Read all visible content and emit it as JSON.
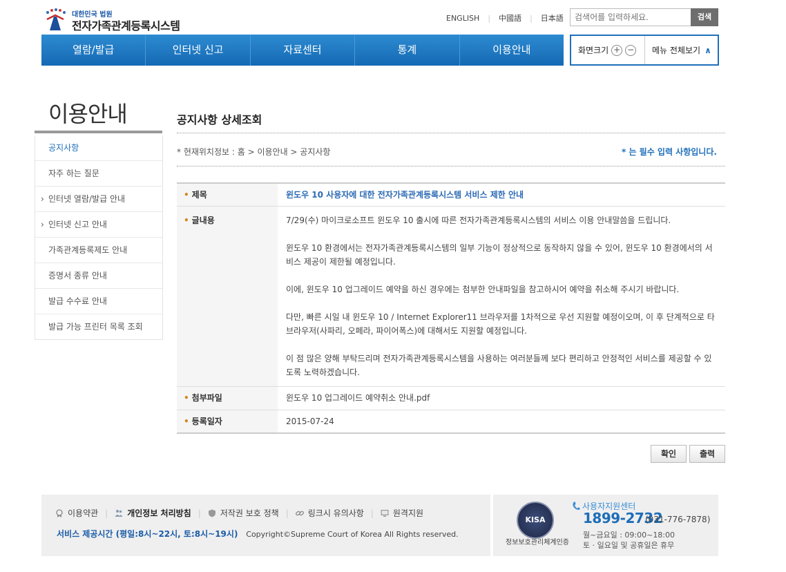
{
  "header": {
    "logo_top": "대한민국 법원",
    "logo_main": "전자가족관계등록시스템",
    "lang_en": "ENGLISH",
    "lang_zh": "中國語",
    "lang_ja": "日本語",
    "search_placeholder": "검색어를 입력하세요.",
    "search_button": "검색"
  },
  "gnb": {
    "items": [
      "열람/발급",
      "인터넷 신고",
      "자료센터",
      "통계",
      "이용안내"
    ]
  },
  "util": {
    "zoom_label": "화면크기",
    "zoom_in": "+",
    "zoom_out": "−",
    "menu_all": "메뉴 전체보기",
    "menu_chevron": "∧"
  },
  "side": {
    "title": "이용안내",
    "items": [
      {
        "label": "공지사항",
        "arrow": ""
      },
      {
        "label": "자주 하는 질문",
        "arrow": ""
      },
      {
        "label": "인터넷 열람/발급 안내",
        "arrow": "›"
      },
      {
        "label": "인터넷 신고 안내",
        "arrow": "›"
      },
      {
        "label": "가족관계등록제도 안내",
        "arrow": ""
      },
      {
        "label": "증명서 종류 안내",
        "arrow": ""
      },
      {
        "label": "발급 수수료 안내",
        "arrow": ""
      },
      {
        "label": "발급 가능 프린터 목록 조회",
        "arrow": ""
      }
    ]
  },
  "main": {
    "page_title": "공지사항 상세조회",
    "location": "* 현재위치정보 : 홈 > 이용안내 > 공지사항",
    "required_note": "* 는 필수 입력 사항입니다.",
    "bullet": "•",
    "title_label": "제목",
    "title_value": "윈도우 10 사용자에 대한 전자가족관계등록시스템 서비스 제한 안내",
    "body_label": "글내용",
    "body_paragraphs": [
      "7/29(수) 마이크로소프트 윈도우 10 출시에 따른 전자가족관계등록시스템의 서비스 이용 안내말씀을 드립니다.",
      "윈도우 10 환경에서는 전자가족관계등록시스템의 일부 기능이 정상적으로 동작하지 않을 수 있어, 윈도우 10 환경에서의 서비스 제공이 제한될 예정입니다.",
      "이에, 윈도우 10 업그레이드 예약을 하신 경우에는 첨부한 안내파일을 참고하시어 예약을 취소해 주시기 바랍니다.",
      "다만, 빠른 시일 내 윈도우 10 / Internet Explorer11 브라우저를 1차적으로 우선 지원할 예정이오며, 이 후 단계적으로 타 브라우저(사파리, 오페라, 파이어폭스)에 대해서도 지원할 예정입니다.",
      "이 점 많은 양해 부탁드리며 전자가족관계등록시스템을 사용하는 여러분들께 보다 편리하고 안정적인 서비스를 제공할 수 있도록 노력하겠습니다."
    ],
    "file_label": "첨부파일",
    "file_value": "윈도우 10 업그레이드 예약취소 안내.pdf",
    "date_label": "등록일자",
    "date_value": "2015-07-24",
    "ok_button": "확인",
    "print_button": "출력"
  },
  "footer": {
    "links": [
      "이용약관",
      "개인정보 처리방침",
      "저작권 보호 정책",
      "링크시 유의사항",
      "원격지원"
    ],
    "hours": "서비스 제공시간 (평일:8시~22시, 토:8시~19시)",
    "copyright": "Copyright©Supreme Court of Korea All Rights reserved.",
    "kisa_caption": "정보보호관리체계인증",
    "center_title": "사용자지원센터",
    "center_phone": "1899-2732",
    "center_phone_sub": "(031-776-7878)",
    "center_hours1": "월~금요일 : 09:00~18:00",
    "center_hours2": "토 · 일요일 및 공휴일은 휴무"
  }
}
